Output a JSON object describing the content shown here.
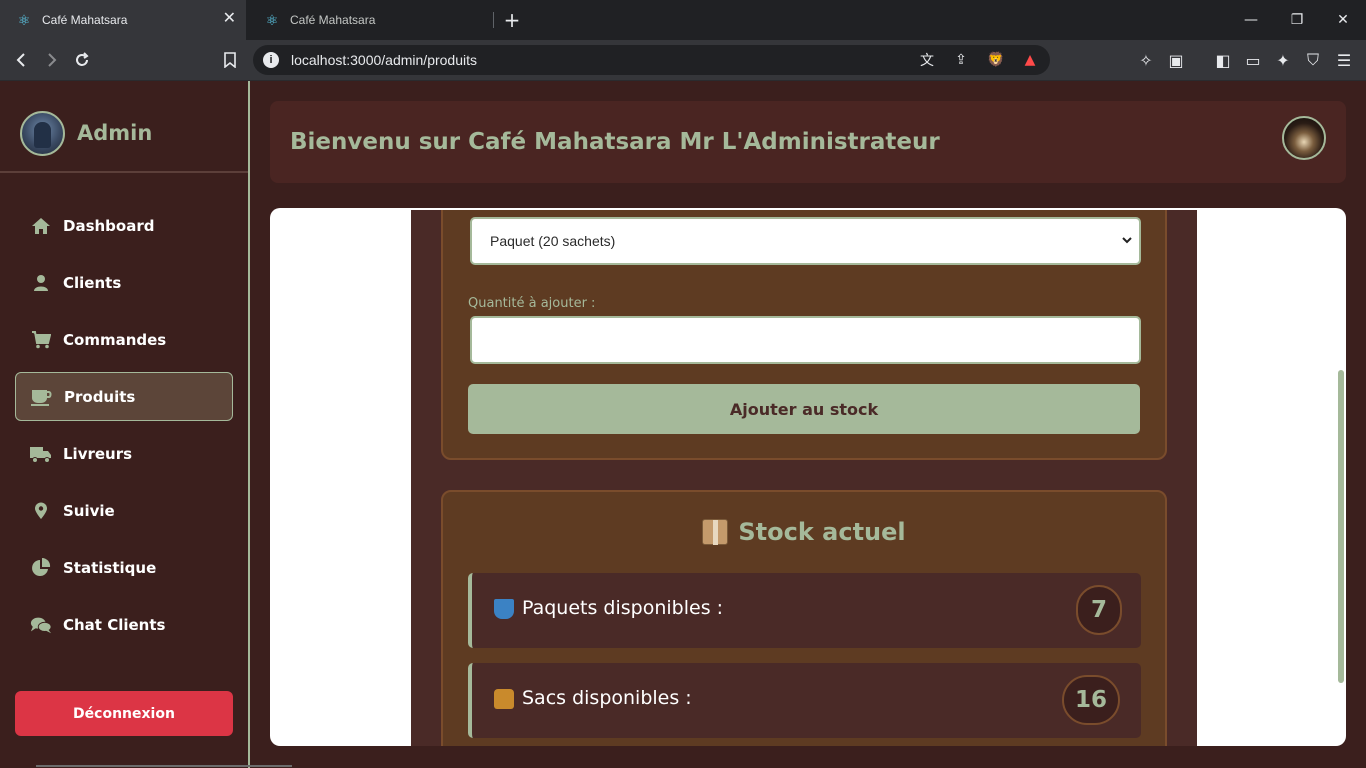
{
  "browser": {
    "tabs": [
      {
        "title": "Café Mahatsara",
        "active": true
      },
      {
        "title": "Café Mahatsara",
        "active": false
      }
    ],
    "url": "localhost:3000/admin/produits"
  },
  "sidebar": {
    "admin_name": "Admin",
    "items": [
      {
        "label": "Dashboard",
        "icon": "home-icon"
      },
      {
        "label": "Clients",
        "icon": "user-icon"
      },
      {
        "label": "Commandes",
        "icon": "cart-icon"
      },
      {
        "label": "Produits",
        "icon": "coffee-cup-icon",
        "active": true
      },
      {
        "label": "Livreurs",
        "icon": "truck-icon"
      },
      {
        "label": "Suivie",
        "icon": "map-pin-icon"
      },
      {
        "label": "Statistique",
        "icon": "pie-chart-icon"
      },
      {
        "label": "Chat Clients",
        "icon": "chat-icon"
      }
    ],
    "logout_label": "Déconnexion"
  },
  "header": {
    "title": "Bienvenu sur Café Mahatsara Mr L'Administrateur"
  },
  "form": {
    "product_type_selected": "Paquet (20 sachets)",
    "quantity_label": "Quantité à ajouter :",
    "quantity_value": "",
    "submit_label": "Ajouter au stock"
  },
  "stock": {
    "title": "Stock actuel",
    "rows": [
      {
        "label": "Paquets disponibles :",
        "value": "7"
      },
      {
        "label": "Sacs disponibles :",
        "value": "16"
      }
    ]
  },
  "colors": {
    "accent": "#a5b99a",
    "sidebar_bg": "#3b1f1d",
    "card_bg": "#5e3b22",
    "logout": "#dc3545"
  }
}
